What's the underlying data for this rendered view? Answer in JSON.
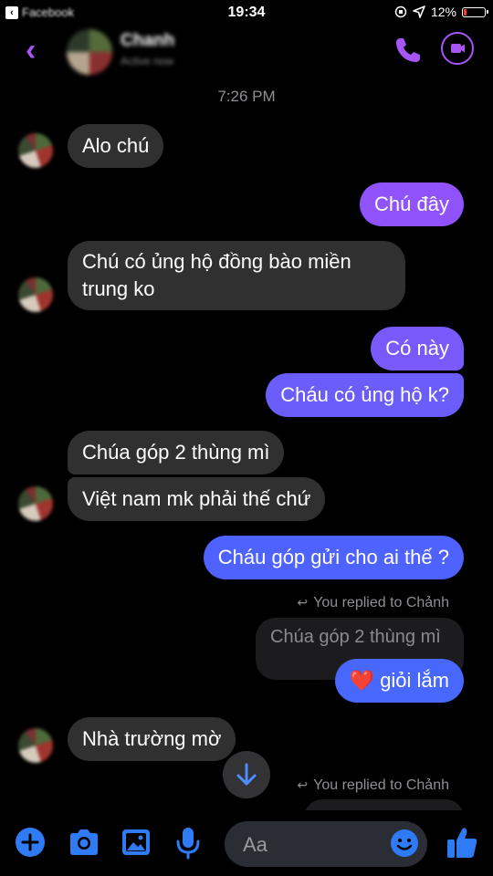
{
  "status_bar": {
    "back_app": "Facebook",
    "time": "19:34",
    "battery": "12%",
    "battery_level": 0.12,
    "low_battery_color": "#ff3b30"
  },
  "header": {
    "contact_name": "Chanh",
    "contact_status": "Active now",
    "accent_color": "#a855f7"
  },
  "timestamp": "7:26 PM",
  "messages": {
    "m1": "Alo chú",
    "m2": "Chú đây",
    "m3_line1": "Chú có ủng hộ đồng bào miền",
    "m3_line2": "trung ko",
    "m4": "Có này",
    "m5": "Cháu có ủng hộ k?",
    "m6": "Chúa góp 2 thùng mì",
    "m7": "Việt nam mk phải thế chứ",
    "m8": "Cháu góp gửi cho ai thế ?",
    "reply_note_1": "You replied to Chảnh",
    "quoted_1": "Chúa góp 2 thùng mì",
    "m9": "giỏi lắm",
    "m9_emoji": "❤️",
    "m10": "Nhà trường mờ",
    "reply_note_2": "You replied to Chảnh"
  },
  "colors": {
    "outgoing_top": "#9a4dff",
    "outgoing_bottom": "#4a63ff",
    "incoming": "#303030"
  },
  "composer": {
    "placeholder": "Aa",
    "icons": [
      "plus-icon",
      "camera-icon",
      "image-icon",
      "microphone-icon",
      "emoji-icon",
      "thumbs-up-icon"
    ]
  }
}
